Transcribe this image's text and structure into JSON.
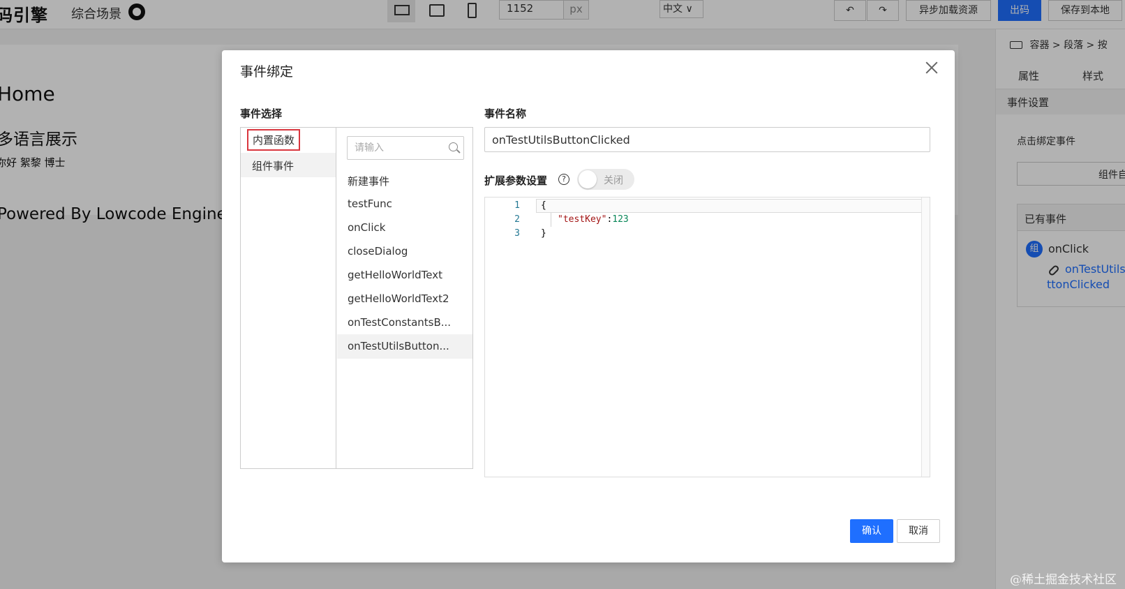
{
  "topbar": {
    "logo": "码引擎",
    "scene": "综合场景",
    "width_value": "1152",
    "width_unit": "px",
    "lang": "中文",
    "async_label": "异步加载资源",
    "code_label": "出码",
    "save_label": "保存到本地"
  },
  "canvas": {
    "home": "Home",
    "lang_title": "多语言展示",
    "hello": "你好  絮黎 博士",
    "powered": "Powered By Lowcode Engine"
  },
  "right_panel": {
    "breadcrumb": [
      "容器",
      "段落",
      "按"
    ],
    "tabs": [
      "属性",
      "样式"
    ],
    "section": "事件设置",
    "click_title": "点击绑定事件",
    "comp_button": "组件自",
    "existing_title": "已有事件",
    "event_badge": "组",
    "event_name": "onClick",
    "event_handler": "onTestUtilsButtonClicked"
  },
  "modal": {
    "title": "事件绑定",
    "select_title": "事件选择",
    "categories": [
      "内置函数",
      "组件事件"
    ],
    "search_placeholder": "请输入",
    "functions": [
      "新建事件",
      "testFunc",
      "onClick",
      "closeDialog",
      "getHelloWorldText",
      "getHelloWorldText2",
      "onTestConstantsB...",
      "onTestUtilsButton..."
    ],
    "name_title": "事件名称",
    "event_name_value": "onTestUtilsButtonClicked",
    "ext_title": "扩展参数设置",
    "toggle_label": "关闭",
    "editor": {
      "line_numbers": [
        "1",
        "2",
        "3"
      ],
      "line1": "{",
      "line2_key": "\"testKey\"",
      "line2_sep": ":",
      "line2_val": "123",
      "line3": "}"
    },
    "confirm_label": "确认",
    "cancel_label": "取消"
  },
  "watermark": "@稀土掘金技术社区",
  "colors": {
    "primary": "#1f6fff",
    "highlight_border": "#d9363e"
  }
}
